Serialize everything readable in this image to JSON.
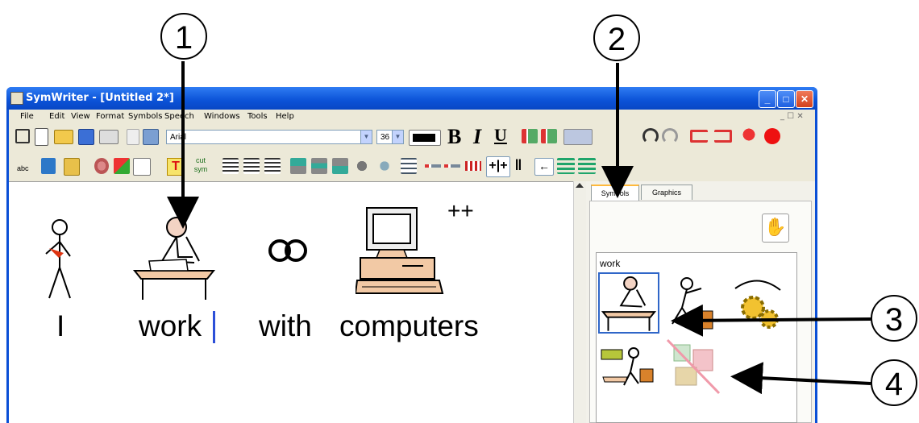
{
  "callouts": [
    "1",
    "2",
    "3",
    "4"
  ],
  "window": {
    "title": "SymWriter - [Untitled 2*]",
    "caption_buttons": [
      "_",
      "□",
      "✕"
    ]
  },
  "menu": [
    "File",
    "Edit",
    "View",
    "Format",
    "Symbols",
    "Speech",
    "Windows",
    "Tools",
    "Help"
  ],
  "menu_right": "_ ☐ ✕",
  "toolbar": {
    "font_name": "Arial",
    "font_size": "36",
    "bold": "B",
    "italic": "I",
    "underline": "U",
    "cut_sym": "cut sym",
    "text_tool": "T",
    "spell": "abc"
  },
  "document": {
    "words": [
      "I",
      "work",
      "with",
      "computers"
    ],
    "plus_marker": "++"
  },
  "panel": {
    "tabs": [
      "Symbols",
      "Graphics"
    ],
    "choice_label": "work"
  },
  "colors": {
    "titlebar": "#0b52d7",
    "selection_outline": "#2f66c8",
    "cursor": "#2c4fd8"
  }
}
